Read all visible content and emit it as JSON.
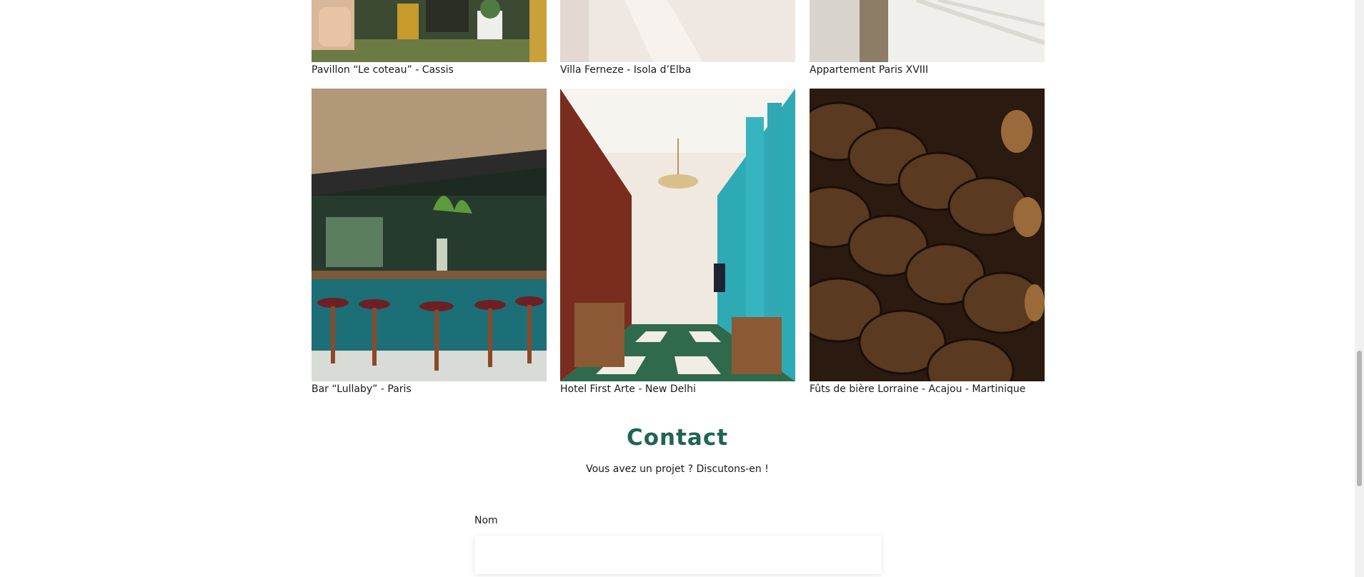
{
  "gallery": {
    "items": [
      {
        "id": "pavillon",
        "caption": "Pavillon “Le coteau” - Cassis"
      },
      {
        "id": "villa",
        "caption": "Villa Ferneze - Isola d’Elba"
      },
      {
        "id": "appart",
        "caption": "Appartement Paris XVIII"
      },
      {
        "id": "bar",
        "caption": "Bar “Lullaby” - Paris"
      },
      {
        "id": "hotel",
        "caption": "Hotel First Arte - New Delhi"
      },
      {
        "id": "futs",
        "caption": "Fûts de bière Lorraine - Acajou - Martinique"
      }
    ]
  },
  "contact": {
    "title": "Contact",
    "subtitle": "Vous avez un projet ? Discutons-en !",
    "name_label": "Nom",
    "name_value": ""
  },
  "colors": {
    "accent": "#1e6553"
  }
}
